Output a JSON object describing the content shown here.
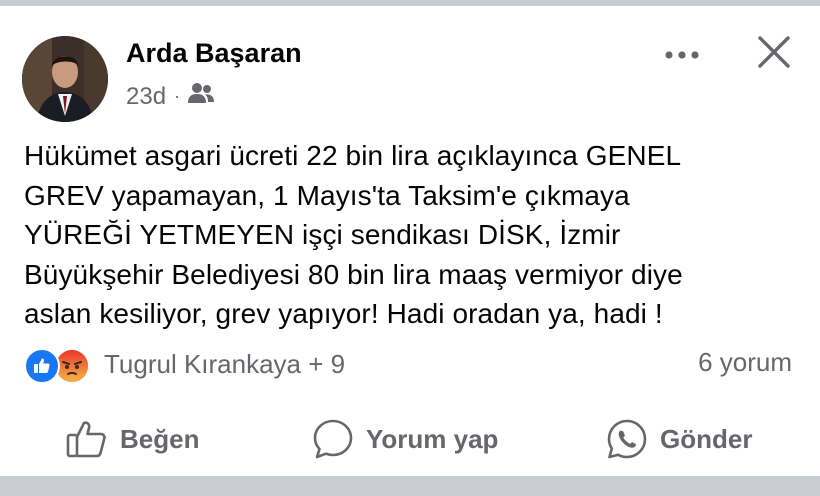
{
  "post": {
    "author": "Arda Başaran",
    "time": "23d",
    "separator": "·",
    "audience_icon": "friends-icon",
    "text": "Hükümet asgari ücreti 22 bin lira açıklayınca GENEL\nGREV yapamayan, 1 Mayıs'ta Taksim'e çıkmaya\nYÜREĞİ YETMEYEN işçi sendikası DİSK, İzmir\nBüyükşehir Belediyesi 80 bin lira maaş vermiyor diye\naslan kesiliyor, grev yapıyor! Hadi oradan ya, hadi !"
  },
  "reactions": {
    "icons": [
      "like-reaction-icon",
      "angry-reaction-icon"
    ],
    "names": "Tugrul Kırankaya + 9",
    "comments": "6 yorum"
  },
  "actions": {
    "like": "Beğen",
    "comment": "Yorum yap",
    "send": "Gönder"
  },
  "colors": {
    "text": "#050505",
    "secondary": "#65676b",
    "like_blue": "#1877f2",
    "angry_orange": "#f25a33",
    "frame": "#c9ccd1"
  }
}
